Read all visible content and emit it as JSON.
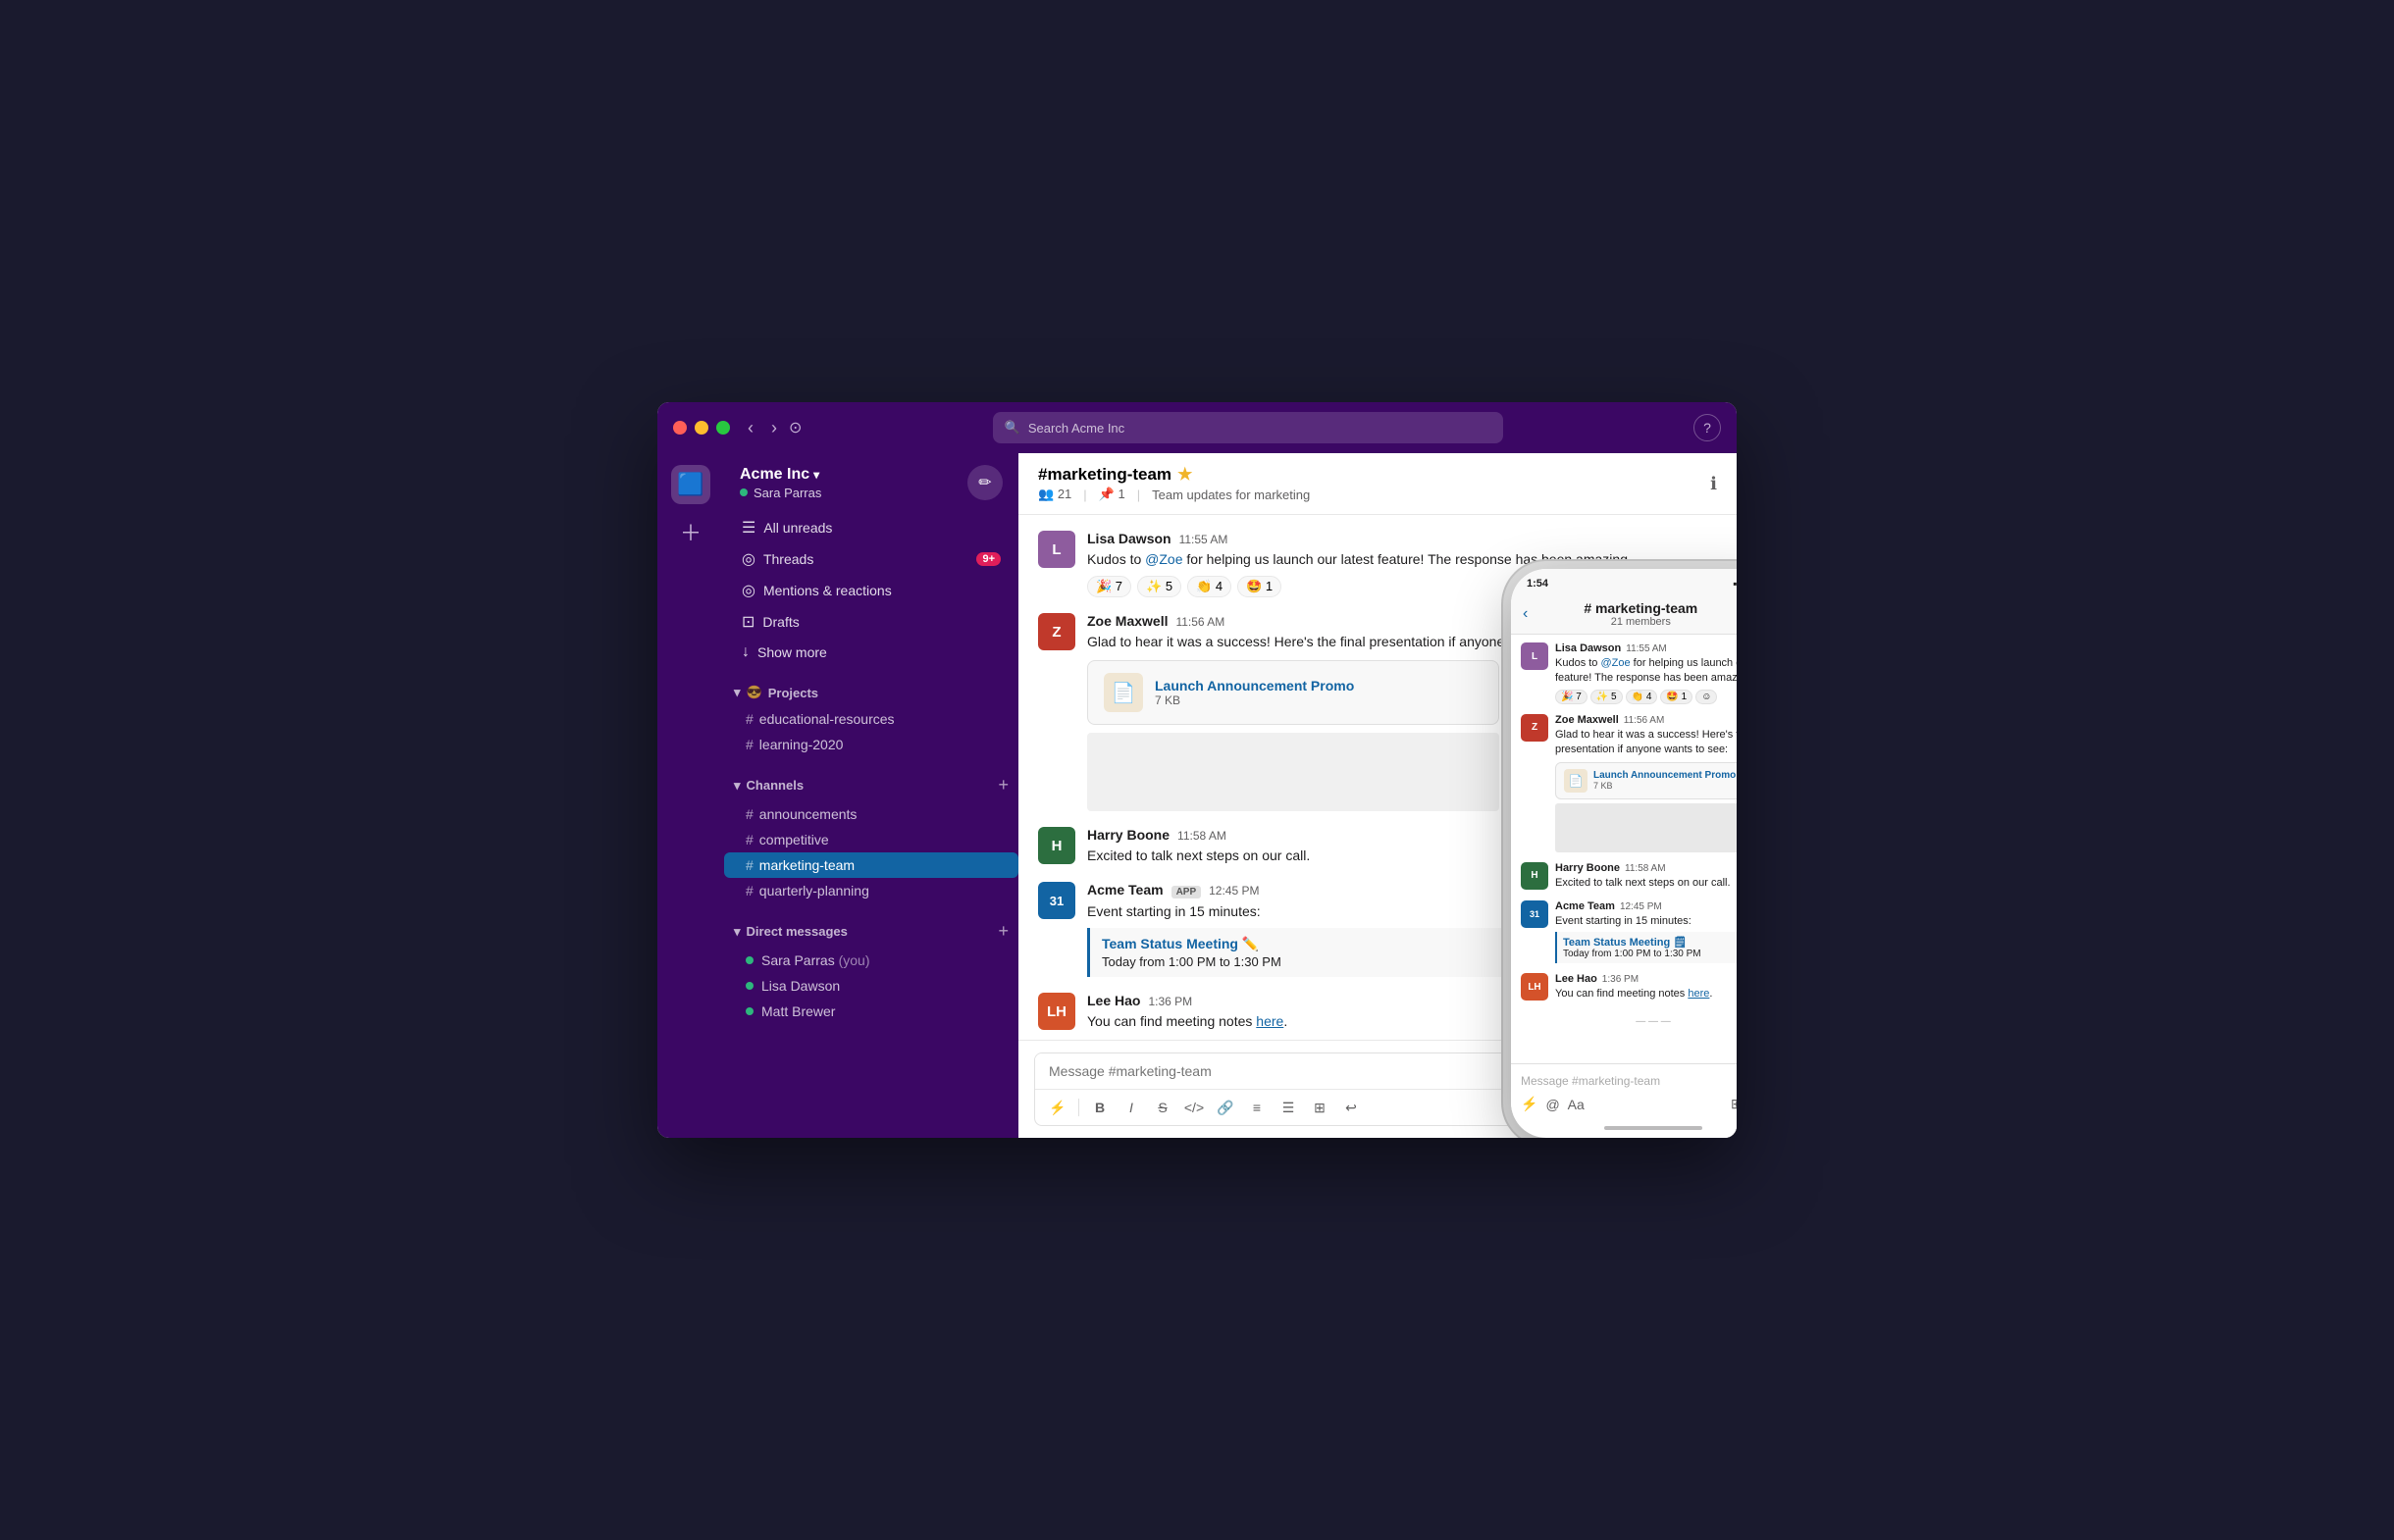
{
  "titlebar": {
    "search_placeholder": "Search Acme Inc",
    "help_label": "?"
  },
  "sidebar": {
    "workspace_name": "Acme Inc",
    "user_name": "Sara Parras",
    "nav_items": [
      {
        "id": "unreads",
        "icon": "☰",
        "label": "All unreads",
        "badge": null
      },
      {
        "id": "threads",
        "icon": "◎",
        "label": "Threads",
        "badge": "9+"
      },
      {
        "id": "mentions",
        "icon": "◎",
        "label": "Mentions & reactions",
        "badge": null
      },
      {
        "id": "drafts",
        "icon": "⊡",
        "label": "Drafts",
        "badge": null
      },
      {
        "id": "show-more",
        "icon": "↓",
        "label": "Show more",
        "badge": null
      }
    ],
    "projects_section": {
      "label": "Projects",
      "emoji": "😎",
      "channels": [
        "educational-resources",
        "learning-2020"
      ]
    },
    "channels_section": {
      "label": "Channels",
      "channels": [
        "announcements",
        "competitive",
        "marketing-team",
        "quarterly-planning"
      ]
    },
    "dm_section": {
      "label": "Direct messages",
      "users": [
        {
          "name": "Sara Parras",
          "you": true
        },
        {
          "name": "Lisa Dawson"
        },
        {
          "name": "Matt Brewer"
        }
      ]
    }
  },
  "chat": {
    "channel_name": "#marketing-team",
    "channel_star": "★",
    "channel_members": "21",
    "channel_pins": "1",
    "channel_description": "Team updates for marketing",
    "messages": [
      {
        "id": "msg1",
        "author": "Lisa Dawson",
        "time": "11:55 AM",
        "avatar_letter": "L",
        "avatar_class": "lisa",
        "text_parts": [
          {
            "type": "text",
            "content": "Kudos to "
          },
          {
            "type": "mention",
            "content": "@Zoe"
          },
          {
            "type": "text",
            "content": " for helping us launch our latest feature! The response has been amazing."
          }
        ],
        "reactions": [
          {
            "emoji": "🎉",
            "count": "7"
          },
          {
            "emoji": "✨",
            "count": "5"
          },
          {
            "emoji": "👏",
            "count": "4"
          },
          {
            "emoji": "🤩",
            "count": "1"
          }
        ]
      },
      {
        "id": "msg2",
        "author": "Zoe Maxwell",
        "time": "11:56 AM",
        "avatar_letter": "Z",
        "avatar_class": "zoe",
        "text": "Glad to hear it was a success! Here's the final presentation if anyone wants to see:",
        "file": {
          "name": "Launch Announcement Promo",
          "size": "7 KB",
          "icon": "📄"
        }
      },
      {
        "id": "msg3",
        "author": "Harry Boone",
        "time": "11:58 AM",
        "avatar_letter": "H",
        "avatar_class": "harry",
        "text": "Excited to talk next steps on our call."
      },
      {
        "id": "msg4",
        "author": "Acme Team",
        "time": "12:45 PM",
        "avatar_text": "31",
        "avatar_class": "acme",
        "app_badge": "APP",
        "text_before": "Event starting in 15 minutes:",
        "event": {
          "title": "Team Status Meeting",
          "emoji": "✏️",
          "time": "Today from 1:00 PM to 1:30 PM"
        }
      },
      {
        "id": "msg5",
        "author": "Lee Hao",
        "time": "1:36 PM",
        "avatar_letter": "LH",
        "avatar_class": "lee",
        "text_parts": [
          {
            "type": "text",
            "content": "You can find meeting notes "
          },
          {
            "type": "link",
            "content": "here"
          },
          {
            "type": "text",
            "content": "."
          }
        ]
      }
    ],
    "input_placeholder": "Message #marketing-team"
  },
  "phone": {
    "status_time": "1:54",
    "channel_name": "# marketing-team",
    "channel_members": "21 members",
    "messages": [
      {
        "author": "Lisa Dawson",
        "time": "11:55 AM",
        "text": "Kudos to @Zoe for helping us launch our latest feature! The response has been amazing.",
        "reactions": [
          "🎉 7",
          "✨ 5",
          "👏 4",
          "🤩 1",
          "☺"
        ]
      },
      {
        "author": "Zoe Maxwell",
        "time": "11:56 AM",
        "text": "Glad to hear it was a success! Here's the final presentation if anyone wants to see:",
        "has_file": true,
        "file_name": "Launch Announcement Promo",
        "file_size": "7 KB"
      },
      {
        "author": "Harry Boone",
        "time": "11:58 AM",
        "text": "Excited to talk next steps on our call."
      },
      {
        "author": "Acme Team",
        "time": "12:45 PM",
        "text": "Event starting in 15 minutes:",
        "has_event": true,
        "event_title": "Team Status Meeting 🗒",
        "event_time": "Today from 1:00 PM to 1:30 PM"
      },
      {
        "author": "Lee Hao",
        "time": "1:36 PM",
        "text": "You can find meeting notes here."
      }
    ],
    "input_placeholder": "Message #marketing-team"
  }
}
